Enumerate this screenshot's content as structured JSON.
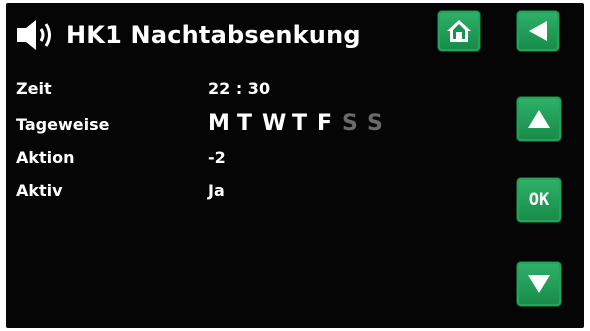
{
  "header": {
    "title": "HK1 Nachtabsenkung",
    "icon": "speaker-icon"
  },
  "nav": {
    "home_icon": "home-icon",
    "back_icon": "back-arrow-icon",
    "up_icon": "up-arrow-icon",
    "down_icon": "down-arrow-icon",
    "ok_label": "OK"
  },
  "fields": {
    "zeit": {
      "label": "Zeit",
      "value": "22 : 30"
    },
    "tageweise": {
      "label": "Tageweise",
      "days": [
        {
          "letter": "M",
          "active": true
        },
        {
          "letter": "T",
          "active": true
        },
        {
          "letter": "W",
          "active": true
        },
        {
          "letter": "T",
          "active": true
        },
        {
          "letter": "F",
          "active": true
        },
        {
          "letter": "S",
          "active": false
        },
        {
          "letter": "S",
          "active": false
        }
      ]
    },
    "aktion": {
      "label": "Aktion",
      "value": "-2"
    },
    "aktiv": {
      "label": "Aktiv",
      "value": "Ja"
    }
  },
  "colors": {
    "active_day": "#ffffff",
    "inactive_day": "#6a6a6a",
    "button_green": "#1f9d55"
  }
}
